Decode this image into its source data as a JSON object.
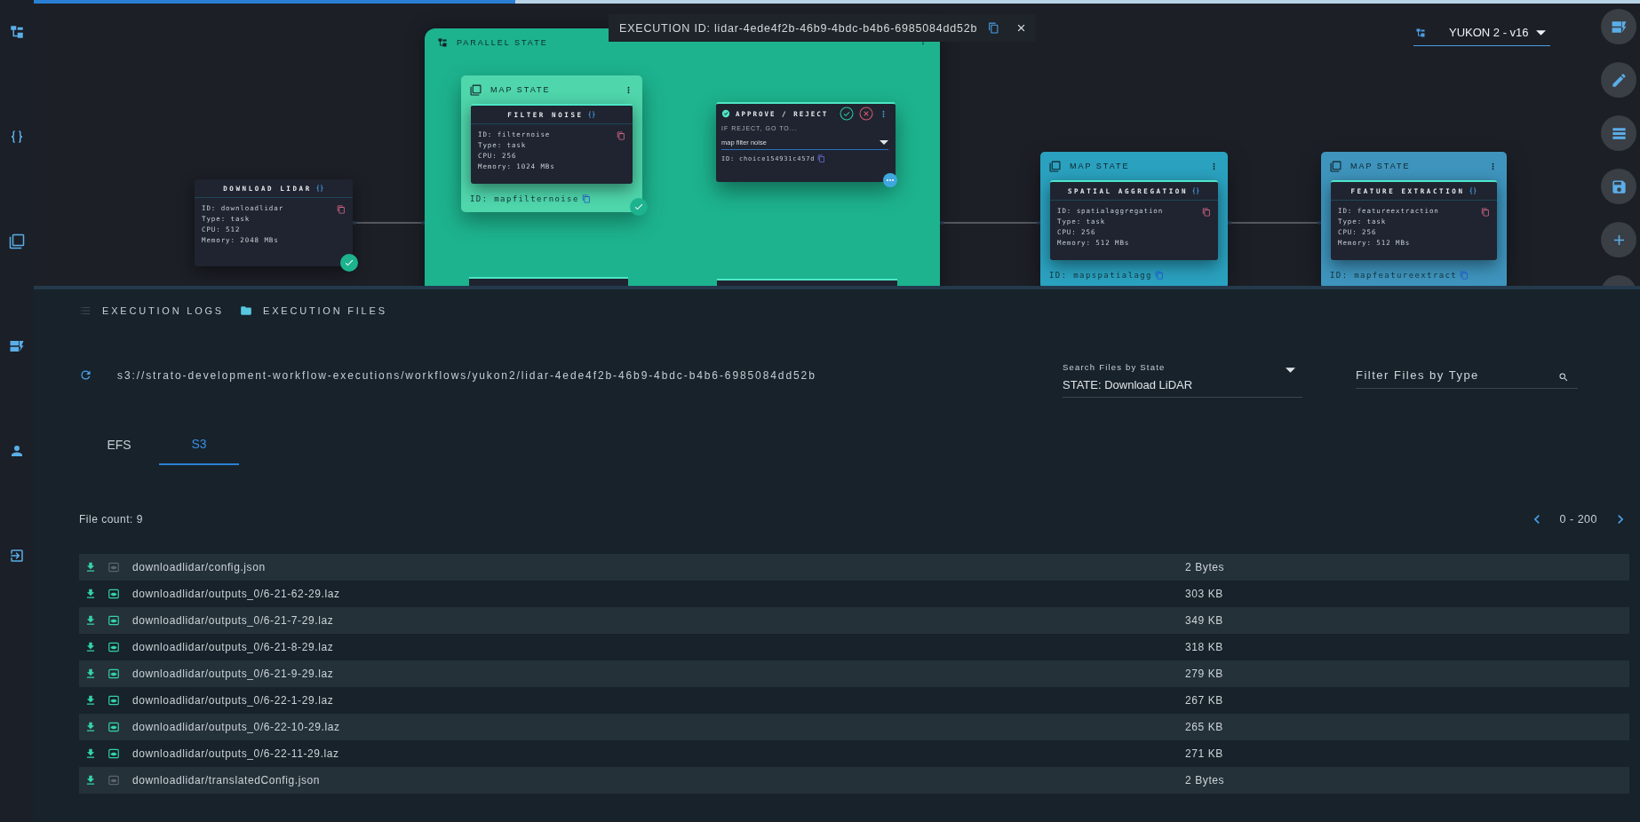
{
  "progress": {
    "level": 0.3
  },
  "canvas": {
    "execution_banner": {
      "label": "EXECUTION ID: lidar-4ede4f2b-46b9-4bdc-b4b6-6985084dd52b"
    },
    "workflow_selector": {
      "value": "YUKON 2 - v16"
    },
    "nodes": [
      {
        "kind": "task",
        "title": "DOWNLOAD LIDAR",
        "details": [
          "ID: downloadlidar",
          "Type: task",
          "CPU: 512",
          "Memory: 2048 MBs"
        ],
        "succeeded": true
      },
      {
        "kind": "parallel",
        "title": "PARALLEL STATE",
        "children": [
          {
            "kind": "map",
            "title": "MAP STATE",
            "color": "#4fd6ab",
            "id_label": "ID: mapfilternoise",
            "succeeded": true,
            "task": {
              "title": "FILTER NOISE",
              "details": [
                "ID: filternoise",
                "Type: task",
                "CPU: 256",
                "Memory: 1024 MBs"
              ]
            }
          },
          {
            "kind": "choice",
            "title": "APPROVE / REJECT",
            "prompt": "IF REJECT, GO TO...",
            "choice": "map filter noise",
            "id_label": "ID: choice154931c457d"
          }
        ]
      },
      {
        "kind": "map",
        "title": "MAP STATE",
        "color": "#2aa1bf",
        "id_label": "ID: mapspatialagg",
        "succeeded": false,
        "task": {
          "title": "SPATIAL AGGREGATION",
          "details": [
            "ID: spatialaggregation",
            "Type: task",
            "CPU: 256",
            "Memory: 512 MBs"
          ]
        }
      },
      {
        "kind": "map",
        "title": "MAP STATE",
        "color": "#3e94bd",
        "id_label": "ID: mapfeatureextract",
        "succeeded": false,
        "task": {
          "title": "FEATURE EXTRACTION",
          "details": [
            "ID: featureextraction",
            "Type: task",
            "CPU: 256",
            "Memory: 512 MBs"
          ]
        }
      }
    ]
  },
  "panel": {
    "tabs": [
      {
        "label": "EXECUTION LOGS",
        "kind": "logs",
        "selected": false
      },
      {
        "label": "EXECUTION FILES",
        "kind": "files",
        "selected": true
      }
    ],
    "path": "s3://strato-development-workflow-executions/workflows/yukon2/lidar-4ede4f2b-46b9-4bdc-b4b6-6985084dd52b",
    "state_filter": {
      "label": "Search Files by State",
      "value": "STATE: Download LiDAR"
    },
    "type_filter": {
      "placeholder": "Filter Files by Type"
    },
    "storage_tabs": [
      {
        "label": "EFS",
        "selected": false
      },
      {
        "label": "S3",
        "selected": true
      }
    ],
    "file_count": "File count: 9",
    "pagination": {
      "range": "0 - 200"
    },
    "rows": [
      {
        "name": "downloadlidar/config.json",
        "size": "2 Bytes",
        "previewable": false
      },
      {
        "name": "downloadlidar/outputs_0/6-21-62-29.laz",
        "size": "303 KB",
        "previewable": true
      },
      {
        "name": "downloadlidar/outputs_0/6-21-7-29.laz",
        "size": "349 KB",
        "previewable": true
      },
      {
        "name": "downloadlidar/outputs_0/6-21-8-29.laz",
        "size": "318 KB",
        "previewable": true
      },
      {
        "name": "downloadlidar/outputs_0/6-21-9-29.laz",
        "size": "279 KB",
        "previewable": true
      },
      {
        "name": "downloadlidar/outputs_0/6-22-1-29.laz",
        "size": "267 KB",
        "previewable": true
      },
      {
        "name": "downloadlidar/outputs_0/6-22-10-29.laz",
        "size": "265 KB",
        "previewable": true
      },
      {
        "name": "downloadlidar/outputs_0/6-22-11-29.laz",
        "size": "271 KB",
        "previewable": true
      },
      {
        "name": "downloadlidar/translatedConfig.json",
        "size": "2 Bytes",
        "previewable": false
      }
    ]
  }
}
